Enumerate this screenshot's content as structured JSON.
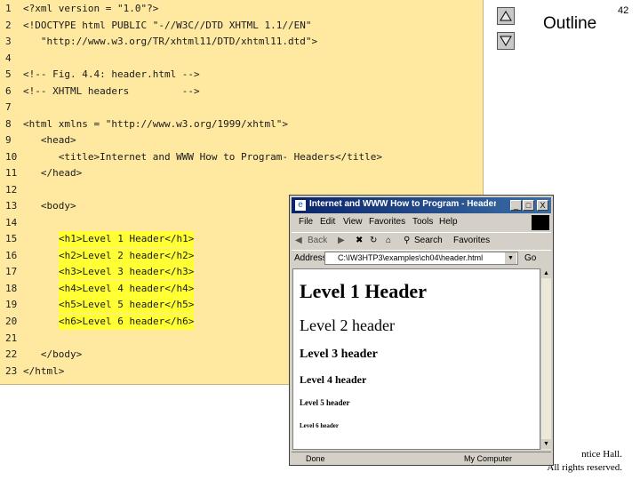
{
  "slide": {
    "page_number": "42",
    "outline_title": "Outline",
    "copyright_line1": "ntice Hall.",
    "copyright_line2": "All rights reserved."
  },
  "code": {
    "lines": [
      {
        "n": "1",
        "text": "<?xml version = \"1.0\"?>",
        "hl": false
      },
      {
        "n": "2",
        "text": "<!DOCTYPE html PUBLIC \"-//W3C//DTD XHTML 1.1//EN\"",
        "hl": false
      },
      {
        "n": "3",
        "text": "   \"http://www.w3.org/TR/xhtml11/DTD/xhtml11.dtd\">",
        "hl": false
      },
      {
        "n": "4",
        "text": "",
        "hl": false
      },
      {
        "n": "5",
        "text": "<!-- Fig. 4.4: header.html -->",
        "hl": false
      },
      {
        "n": "6",
        "text": "<!-- XHTML headers         -->",
        "hl": false
      },
      {
        "n": "7",
        "text": "",
        "hl": false
      },
      {
        "n": "8",
        "text": "<html xmlns = \"http://www.w3.org/1999/xhtml\">",
        "hl": false
      },
      {
        "n": "9",
        "text": "   <head>",
        "hl": false
      },
      {
        "n": "10",
        "text": "      <title>Internet and WWW How to Program- Headers</title>",
        "hl": false
      },
      {
        "n": "11",
        "text": "   </head>",
        "hl": false
      },
      {
        "n": "12",
        "text": "",
        "hl": false
      },
      {
        "n": "13",
        "text": "   <body>",
        "hl": false
      },
      {
        "n": "14",
        "text": "",
        "hl": false
      },
      {
        "n": "15",
        "text": "<h1>Level 1 Header</h1>",
        "hl": true
      },
      {
        "n": "16",
        "text": "<h2>Level 2 header</h2>",
        "hl": true
      },
      {
        "n": "17",
        "text": "<h3>Level 3 header</h3>",
        "hl": true
      },
      {
        "n": "18",
        "text": "<h4>Level 4 header</h4>",
        "hl": true
      },
      {
        "n": "19",
        "text": "<h5>Level 5 header</h5>",
        "hl": true
      },
      {
        "n": "20",
        "text": "<h6>Level 6 header</h6>",
        "hl": true
      },
      {
        "n": "21",
        "text": "",
        "hl": false
      },
      {
        "n": "22",
        "text": "   </body>",
        "hl": false
      },
      {
        "n": "23",
        "text": "</html>",
        "hl": false
      }
    ]
  },
  "browser": {
    "title": "Internet and WWW How to Program - Headers - Mic...",
    "window_buttons": [
      "_",
      "□",
      "X"
    ],
    "menu": [
      "File",
      "Edit",
      "View",
      "Favorites",
      "Tools",
      "Help"
    ],
    "toolbar": [
      "Back",
      "Search",
      "Favorites"
    ],
    "address_label": "Address",
    "address_value": "C:\\IW3HTP3\\examples\\ch04\\header.html",
    "go_label": "Go",
    "headings": [
      "Level 1 Header",
      "Level 2 header",
      "Level 3 header",
      "Level 4 header",
      "Level 5 header",
      "Level 6 header"
    ],
    "status_left": "Done",
    "status_zone": "My Computer"
  },
  "icons": {
    "nav_up": "triangle-up-icon",
    "nav_down": "triangle-down-icon"
  }
}
